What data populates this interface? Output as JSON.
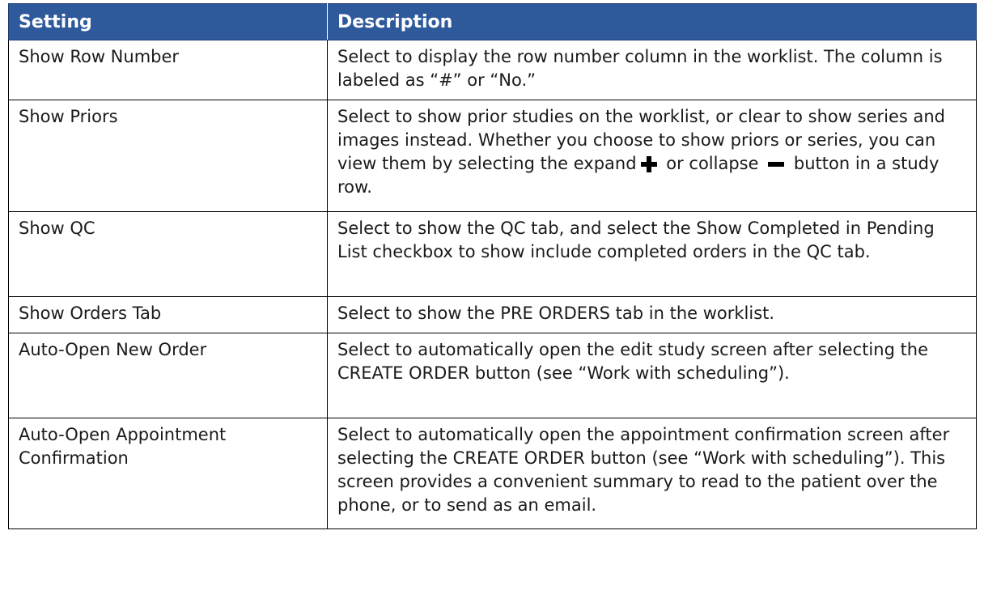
{
  "table": {
    "headers": [
      "Setting",
      "Description"
    ],
    "rows": [
      {
        "setting": "Show Row Number",
        "description": "Select to display the row number column in the worklist. The column is labeled as “#” or “No.”"
      },
      {
        "setting": "Show Priors",
        "description_parts": [
          "Select to show prior studies on the worklist, or clear to show series and images instead. Whether you choose to show priors or series, you can view them by selecting the expand",
          "or collapse",
          "button in a study row."
        ],
        "icons": [
          "plus-icon",
          "minus-icon"
        ]
      },
      {
        "setting": "Show QC",
        "description": "Select to show the QC tab, and select the Show Completed in Pending List checkbox to show include completed orders in the QC tab."
      },
      {
        "setting": "Show Orders Tab",
        "description": "Select to show the PRE ORDERS tab in the worklist."
      },
      {
        "setting": "Auto-Open New Order",
        "description": "Select to automatically open the edit study screen after selecting the CREATE ORDER button (see “Work with scheduling”)."
      },
      {
        "setting": "Auto-Open Appointment Confirmation",
        "description": "Select to automatically open the appointment confirmation screen after selecting the CREATE ORDER button (see “Work with scheduling”). This screen provides a convenient summary to read to the patient over the phone, or to send as an email."
      }
    ]
  },
  "colors": {
    "header_bg": "#2e5a9c",
    "header_text": "#ffffff",
    "border": "#000000"
  }
}
